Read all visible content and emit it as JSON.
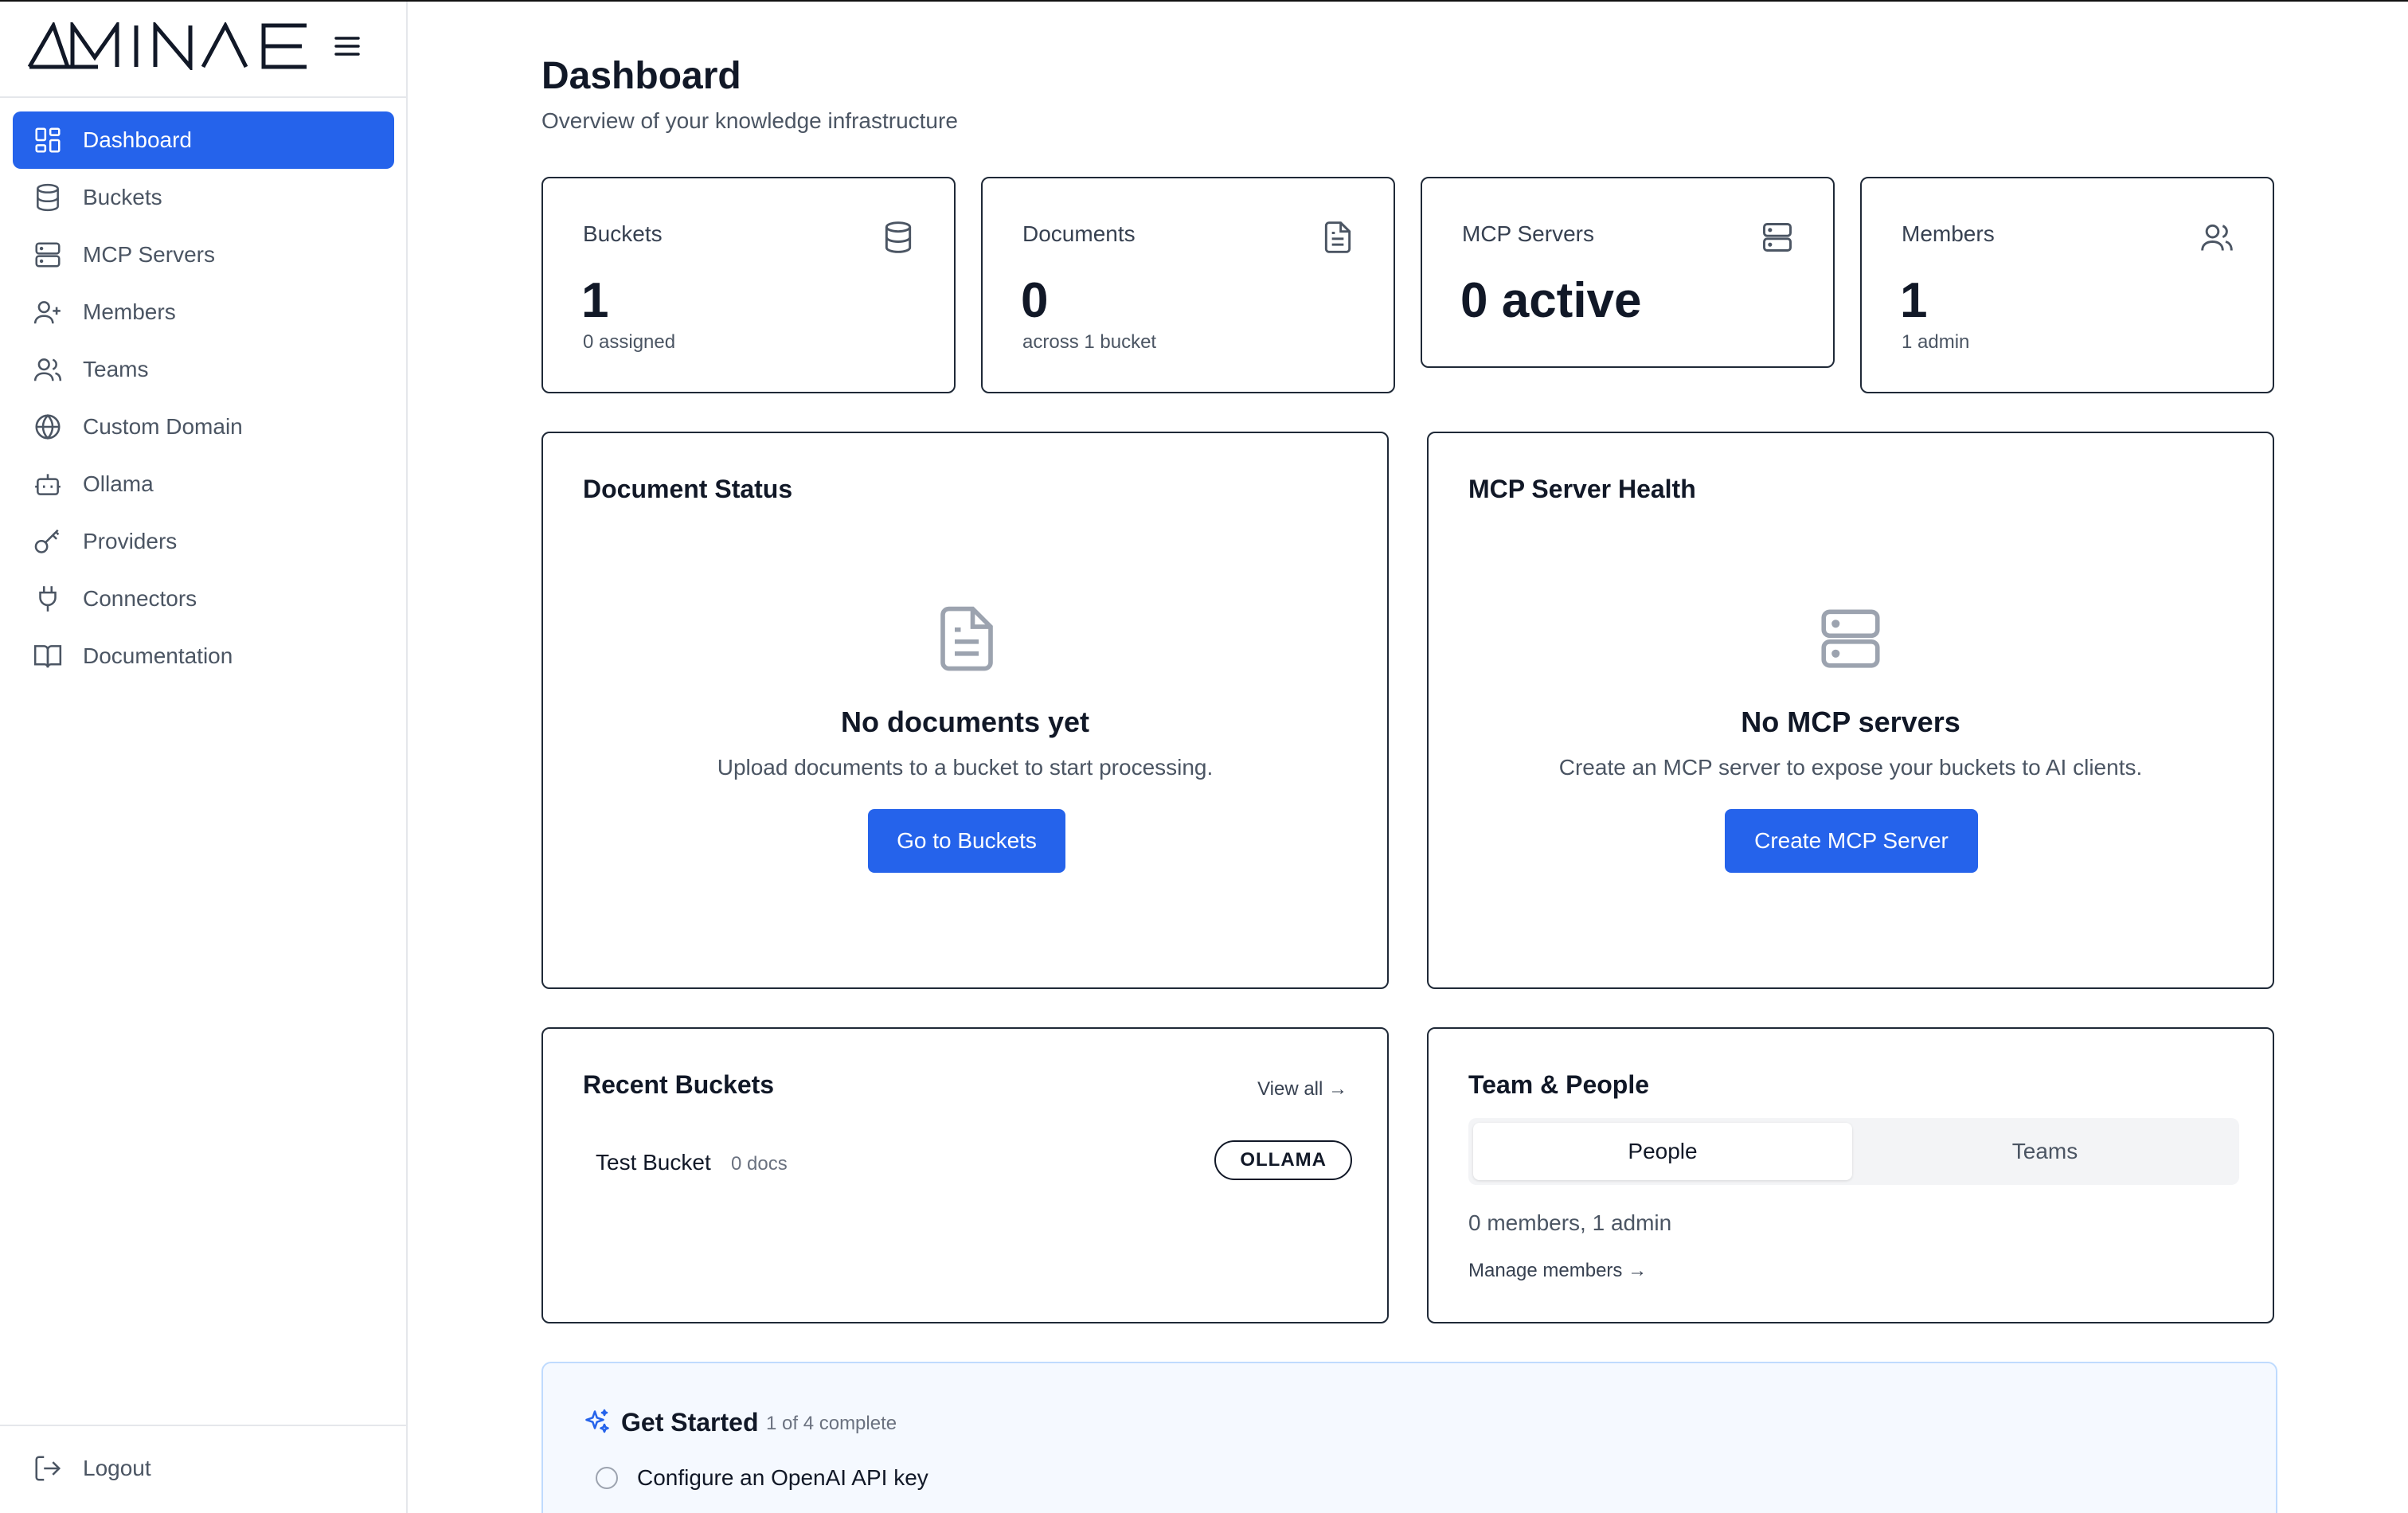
{
  "brand": {
    "logo_text": "AMINAE"
  },
  "sidebar": {
    "items": [
      {
        "label": "Dashboard",
        "icon": "dashboard-icon",
        "active": true
      },
      {
        "label": "Buckets",
        "icon": "database-icon"
      },
      {
        "label": "MCP Servers",
        "icon": "server-icon"
      },
      {
        "label": "Members",
        "icon": "user-plus-icon"
      },
      {
        "label": "Teams",
        "icon": "users-icon"
      },
      {
        "label": "Custom Domain",
        "icon": "globe-icon"
      },
      {
        "label": "Ollama",
        "icon": "bot-icon"
      },
      {
        "label": "Providers",
        "icon": "key-icon"
      },
      {
        "label": "Connectors",
        "icon": "plug-icon"
      },
      {
        "label": "Documentation",
        "icon": "book-icon"
      }
    ],
    "logout_label": "Logout"
  },
  "header": {
    "title": "Dashboard",
    "subtitle": "Overview of your knowledge infrastructure"
  },
  "stats": [
    {
      "label": "Buckets",
      "value": "1",
      "sub": "0 assigned",
      "icon": "database-icon"
    },
    {
      "label": "Documents",
      "value": "0",
      "sub": "across 1 bucket",
      "icon": "file-text-icon"
    },
    {
      "label": "MCP Servers",
      "value": "0 active",
      "sub": "",
      "icon": "server-icon"
    },
    {
      "label": "Members",
      "value": "1",
      "sub": "1 admin",
      "icon": "users-icon"
    }
  ],
  "document_status": {
    "title": "Document Status",
    "empty_title": "No documents yet",
    "empty_text": "Upload documents to a bucket to start processing.",
    "button": "Go to Buckets"
  },
  "mcp_health": {
    "title": "MCP Server Health",
    "empty_title": "No MCP servers",
    "empty_text": "Create an MCP server to expose your buckets to AI clients.",
    "button": "Create MCP Server"
  },
  "recent_buckets": {
    "title": "Recent Buckets",
    "view_all": "View all →",
    "items": [
      {
        "name": "Test Bucket",
        "docs": "0 docs",
        "provider": "OLLAMA"
      }
    ]
  },
  "team_people": {
    "title": "Team & People",
    "tabs": [
      "People",
      "Teams"
    ],
    "active_tab": "People",
    "summary": "0 members, 1 admin",
    "manage_link": "Manage members →"
  },
  "get_started": {
    "title": "Get Started",
    "progress": "1 of 4 complete",
    "tasks": [
      {
        "label": "Configure an OpenAI API key",
        "done": false
      }
    ]
  },
  "colors": {
    "accent": "#2563eb",
    "border": "#1f2937",
    "muted": "#4b5563"
  }
}
